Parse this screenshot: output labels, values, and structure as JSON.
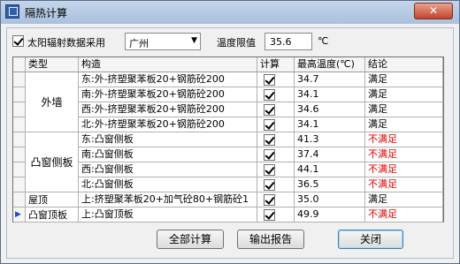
{
  "window": {
    "title": "隔热计算",
    "close_glyph": "✕"
  },
  "toolbar": {
    "solar_checkbox_label": "太阳辐射数据采用",
    "solar_checked": true,
    "city": "广州",
    "temp_limit_label": "温度限值",
    "temp_limit_value": "35.6",
    "temp_unit": "℃"
  },
  "table": {
    "headers": [
      "类型",
      "构造",
      "计算",
      "最高温度(℃)",
      "结论"
    ],
    "groups": [
      {
        "type": "外墙",
        "rows": [
          {
            "construction": "东:外-挤塑聚苯板20+钢筋砼200",
            "calc": true,
            "max_temp": "34.7",
            "result": "满足",
            "ok": true
          },
          {
            "construction": "南:外-挤塑聚苯板20+钢筋砼200",
            "calc": true,
            "max_temp": "34.1",
            "result": "满足",
            "ok": true
          },
          {
            "construction": "西:外-挤塑聚苯板20+钢筋砼200",
            "calc": true,
            "max_temp": "34.6",
            "result": "满足",
            "ok": true
          },
          {
            "construction": "北:外-挤塑聚苯板20+钢筋砼200",
            "calc": true,
            "max_temp": "34.1",
            "result": "满足",
            "ok": true
          }
        ]
      },
      {
        "type": "凸窗侧板",
        "rows": [
          {
            "construction": "东:凸窗侧板",
            "calc": true,
            "max_temp": "41.3",
            "result": "不满足",
            "ok": false
          },
          {
            "construction": "南:凸窗侧板",
            "calc": true,
            "max_temp": "37.4",
            "result": "不满足",
            "ok": false
          },
          {
            "construction": "西:凸窗侧板",
            "calc": true,
            "max_temp": "44.1",
            "result": "不满足",
            "ok": false
          },
          {
            "construction": "北:凸窗侧板",
            "calc": true,
            "max_temp": "36.5",
            "result": "不满足",
            "ok": false
          }
        ]
      },
      {
        "type": "屋顶",
        "rows": [
          {
            "construction": "上:挤塑聚苯板20+加气砼80+钢筋砼1",
            "calc": true,
            "max_temp": "35.0",
            "result": "满足",
            "ok": true
          }
        ]
      },
      {
        "type": "凸窗顶板",
        "current": true,
        "rows": [
          {
            "construction": "上:凸窗顶板",
            "calc": true,
            "max_temp": "49.9",
            "result": "不满足",
            "ok": false
          }
        ]
      }
    ],
    "row_indicator": "▶"
  },
  "buttons": {
    "calc_all": "全部计算",
    "export_report": "输出报告",
    "close": "关闭"
  },
  "colors": {
    "fail": "#e00000",
    "pass": "#000000"
  }
}
